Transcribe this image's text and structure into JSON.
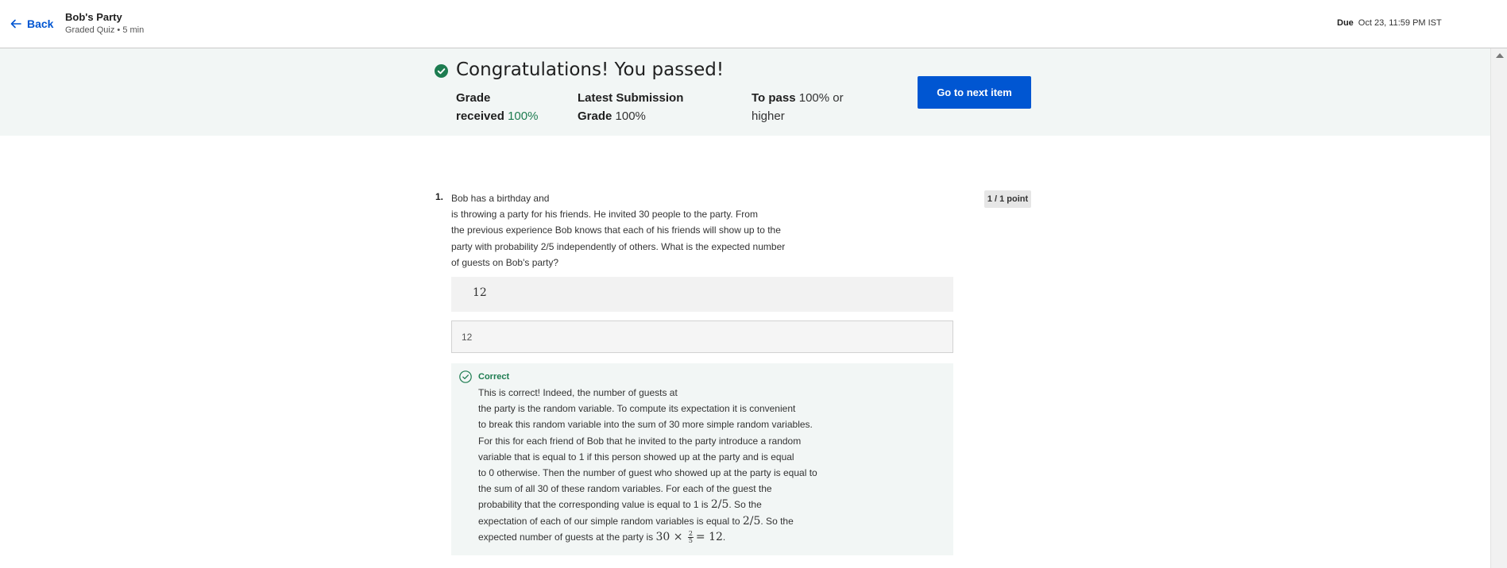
{
  "header": {
    "back_label": "Back",
    "title": "Bob's Party",
    "subtitle": "Graded Quiz • 5 min",
    "due_label": "Due",
    "due_value": "Oct 23, 11:59 PM IST"
  },
  "result": {
    "headline": "Congratulations! You passed!",
    "grade_label_1": "Grade",
    "grade_label_2": "received",
    "grade_value": "100%",
    "latest_label_1": "Latest Submission",
    "latest_label_2": "Grade",
    "latest_value": "100%",
    "pass_label": "To pass",
    "pass_value_1": "100% or",
    "pass_value_2": "higher",
    "next_button": "Go to next item"
  },
  "question": {
    "number": "1.",
    "lines": [
      "Bob has a birthday and",
      "is throwing a party for his friends. He invited 30 people to the party. From",
      "the previous experience Bob knows that each of his friends will show up to the",
      "party with probability 2/5 independently of others. What is the expected number",
      "of guests on Bob's party?"
    ],
    "points": "1 / 1 point",
    "answer_display": "12",
    "answer_input": "12",
    "feedback_label": "Correct",
    "feedback_lines": [
      "This is correct! Indeed, the number of guests at",
      "the party is the random variable. To compute its expectation it is convenient",
      "to break this random variable into the sum of 30 more simple random variables.",
      "For this for each friend of Bob that he invited to the party introduce a random",
      "variable that is equal to 1 if this person showed up at the party and is equal",
      "to 0 otherwise. Then the number of guest who showed up at the party is equal to",
      "the sum of all 30 of these random variables. For each of the guest the"
    ],
    "fb_line8_text": "probability that the corresponding value is equal to 1 is ",
    "fb_line8_math": "2/5",
    "fb_line8_end": ". So the",
    "fb_line9_text": "expectation of each of our simple random variables is equal to ",
    "fb_line9_math": "2/5",
    "fb_line9_end": ". So the",
    "fb_line10_text": "expected number of guests at the party is ",
    "fb_line10_math_a": "30 ×",
    "fb_frac_num": "2",
    "fb_frac_den": "5",
    "fb_line10_math_b": "= 12",
    "fb_line10_end": "."
  }
}
